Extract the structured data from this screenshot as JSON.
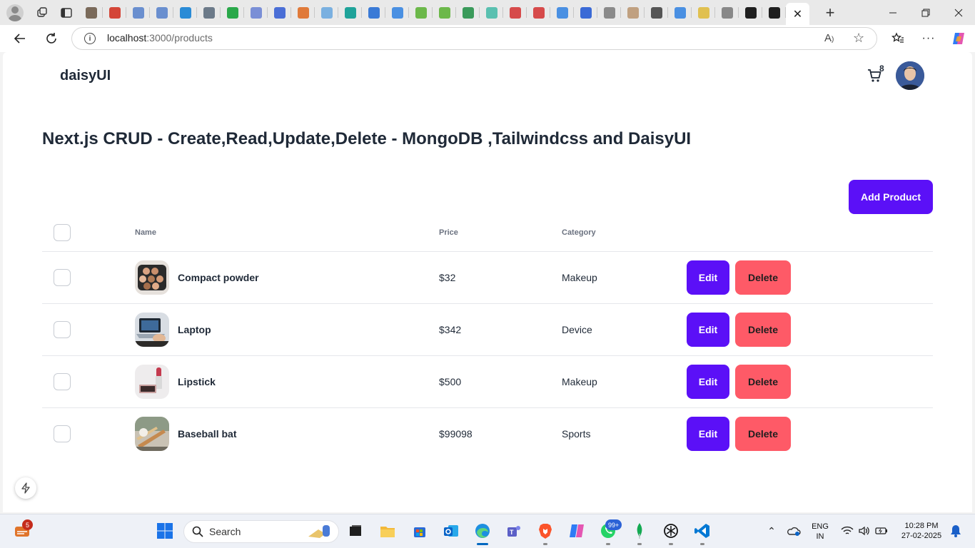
{
  "browser": {
    "url_host": "localhost",
    "url_path": ":3000/products",
    "tabs": [
      {
        "icon": "chat-icon",
        "color": "#7a6a5a"
      },
      {
        "icon": "gmail-icon",
        "color": "#d44638"
      },
      {
        "icon": "azure-icon",
        "color": "#6a8fcf"
      },
      {
        "icon": "azure-icon",
        "color": "#6a8fcf"
      },
      {
        "icon": "sf-icon",
        "color": "#2a8bd6"
      },
      {
        "icon": "un-icon",
        "color": "#6c7a89"
      },
      {
        "icon": "spark-icon",
        "color": "#2aa84a"
      },
      {
        "icon": "link-icon",
        "color": "#7a8fd6"
      },
      {
        "icon": "k-icon",
        "color": "#4a6ed6"
      },
      {
        "icon": "circle-icon",
        "color": "#e07a3a"
      },
      {
        "icon": "cloud-icon",
        "color": "#7ab0e0"
      },
      {
        "icon": "tv-icon",
        "color": "#1fa39a"
      },
      {
        "icon": "tri-icon",
        "color": "#3a7ad6"
      },
      {
        "icon": "search-icon",
        "color": "#4a90e2"
      },
      {
        "icon": "tag-icon",
        "color": "#6cb84a"
      },
      {
        "icon": "tag-icon",
        "color": "#6cb84a"
      },
      {
        "icon": "code-icon",
        "color": "#3a9a5a"
      },
      {
        "icon": "gear-icon",
        "color": "#5ac0b0"
      },
      {
        "icon": "pdf-icon",
        "color": "#d64a4a"
      },
      {
        "icon": "pdf-icon",
        "color": "#d64a4a"
      },
      {
        "icon": "search-icon",
        "color": "#4a90e2"
      },
      {
        "icon": "globe-icon",
        "color": "#3a6ad6"
      },
      {
        "icon": "tcs-icon",
        "color": "#8a8a8a"
      },
      {
        "icon": "dash-icon",
        "color": "#c0a080"
      },
      {
        "icon": "target-icon",
        "color": "#555555"
      },
      {
        "icon": "search-icon",
        "color": "#4a90e2"
      },
      {
        "icon": "smile-icon",
        "color": "#e0c050"
      },
      {
        "icon": "grid-icon",
        "color": "#888888"
      },
      {
        "icon": "github-icon",
        "color": "#1f1f1f"
      },
      {
        "icon": "app-icon",
        "color": "#1f1f1f"
      }
    ]
  },
  "navbar": {
    "brand": "daisyUI",
    "cart_count": "8"
  },
  "main": {
    "heading": "Next.js CRUD - Create,Read,Update,Delete - MongoDB ,Tailwindcss and DaisyUI",
    "add_button": "Add Product",
    "table": {
      "headers": {
        "name": "Name",
        "price": "Price",
        "category": "Category"
      },
      "rows": [
        {
          "name": "Compact powder",
          "price": "$32",
          "category": "Makeup",
          "edit": "Edit",
          "delete": "Delete"
        },
        {
          "name": "Laptop",
          "price": "$342",
          "category": "Device",
          "edit": "Edit",
          "delete": "Delete"
        },
        {
          "name": "Lipstick",
          "price": "$500",
          "category": "Makeup",
          "edit": "Edit",
          "delete": "Delete"
        },
        {
          "name": "Baseball bat",
          "price": "$99098",
          "category": "Sports",
          "edit": "Edit",
          "delete": "Delete"
        }
      ]
    }
  },
  "taskbar": {
    "search_label": "Search",
    "widgets_badge": "5",
    "whatsapp_badge": "99+",
    "language_line1": "ENG",
    "language_line2": "IN",
    "time": "10:28 PM",
    "date": "27-02-2025"
  },
  "colors": {
    "primary": "#5b10f7",
    "danger": "#fe5a67",
    "text": "#1f2937"
  }
}
